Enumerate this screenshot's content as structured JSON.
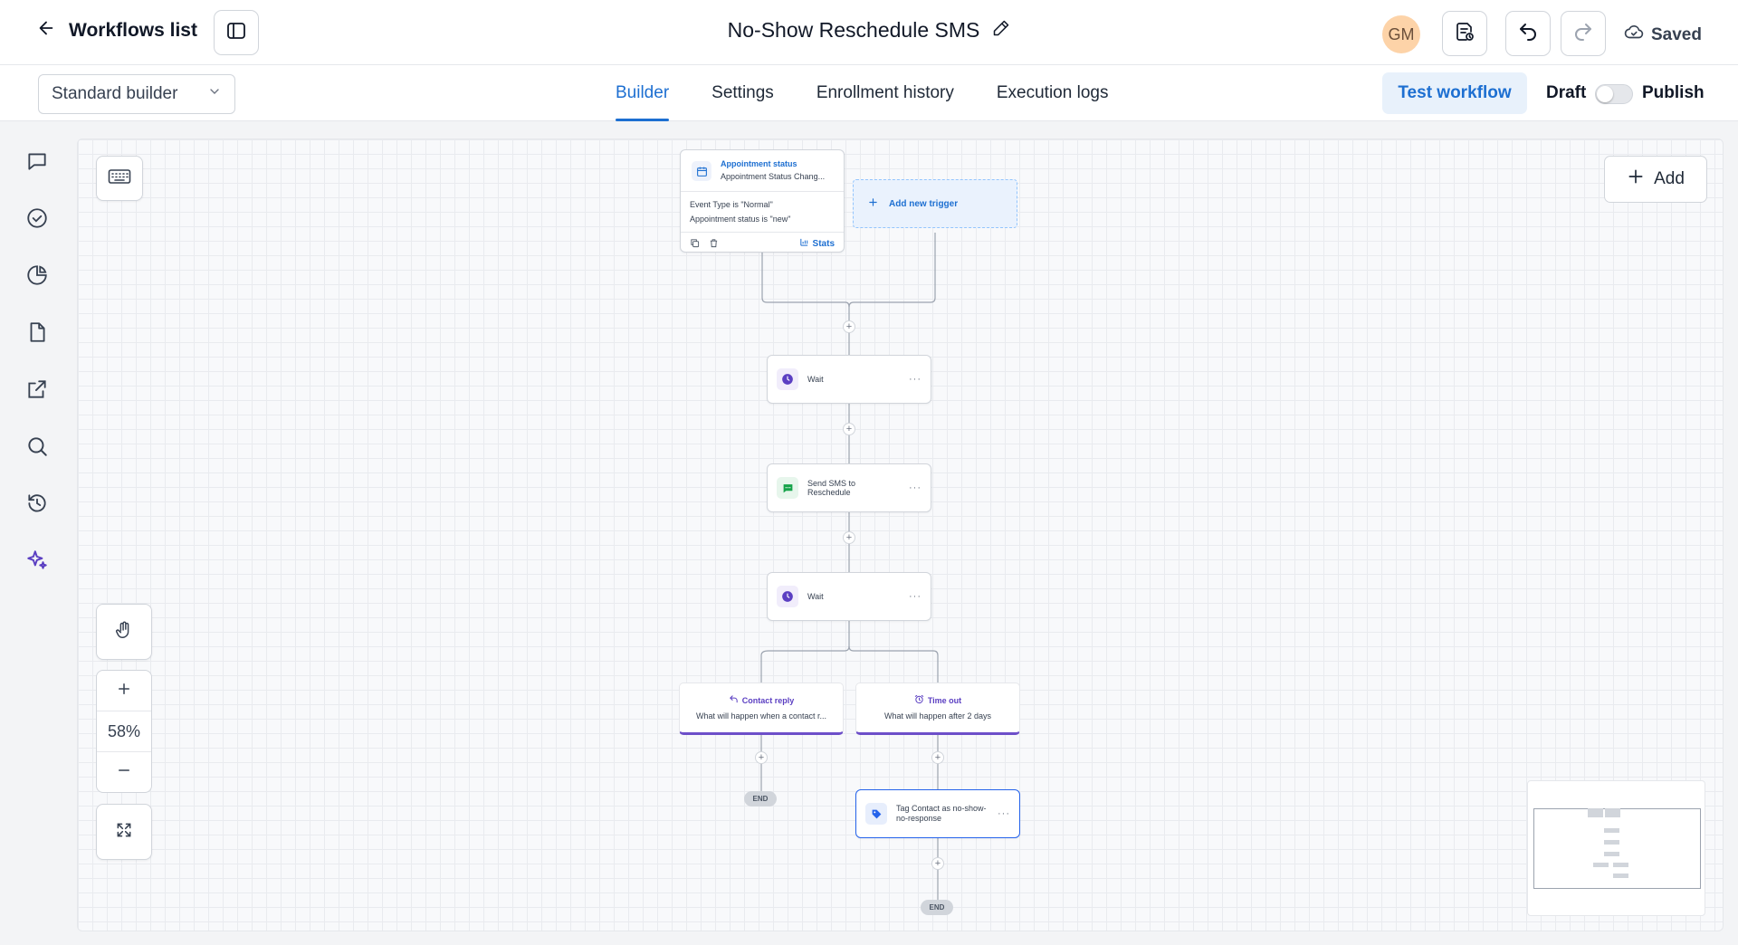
{
  "header": {
    "back_label": "Workflows list",
    "title": "No-Show Reschedule SMS",
    "avatar_initials": "GM",
    "saved_label": "Saved"
  },
  "subbar": {
    "builder_select": "Standard builder",
    "tabs": [
      {
        "label": "Builder",
        "active": true
      },
      {
        "label": "Settings",
        "active": false
      },
      {
        "label": "Enrollment history",
        "active": false
      },
      {
        "label": "Execution logs",
        "active": false
      }
    ],
    "test_label": "Test workflow",
    "draft_label": "Draft",
    "publish_label": "Publish",
    "published": false
  },
  "canvas": {
    "add_label": "Add",
    "zoom": "58%",
    "trigger": {
      "title": "Appointment status",
      "subtitle": "Appointment Status Chang...",
      "filters": [
        "Event Type is \"Normal\"",
        "Appointment status is \"new\""
      ],
      "stats_label": "Stats"
    },
    "add_trigger_label": "Add new trigger",
    "actions": [
      {
        "label": "Wait",
        "icon": "clock-icon"
      },
      {
        "label": "Send SMS to Reschedule",
        "icon": "sms-icon"
      },
      {
        "label": "Wait",
        "icon": "clock-icon"
      }
    ],
    "branches": [
      {
        "title": "Contact reply",
        "desc": "What will happen when a contact r..."
      },
      {
        "title": "Time out",
        "desc": "What will happen after 2 days"
      }
    ],
    "tag_action": {
      "label": "Tag Contact as no-show-no-response"
    },
    "end_label": "END"
  },
  "colors": {
    "accent": "#1d6fd1",
    "branch": "#6d4fc9",
    "wait_icon": "#5b3fc2",
    "sms_icon": "#16a34a"
  }
}
